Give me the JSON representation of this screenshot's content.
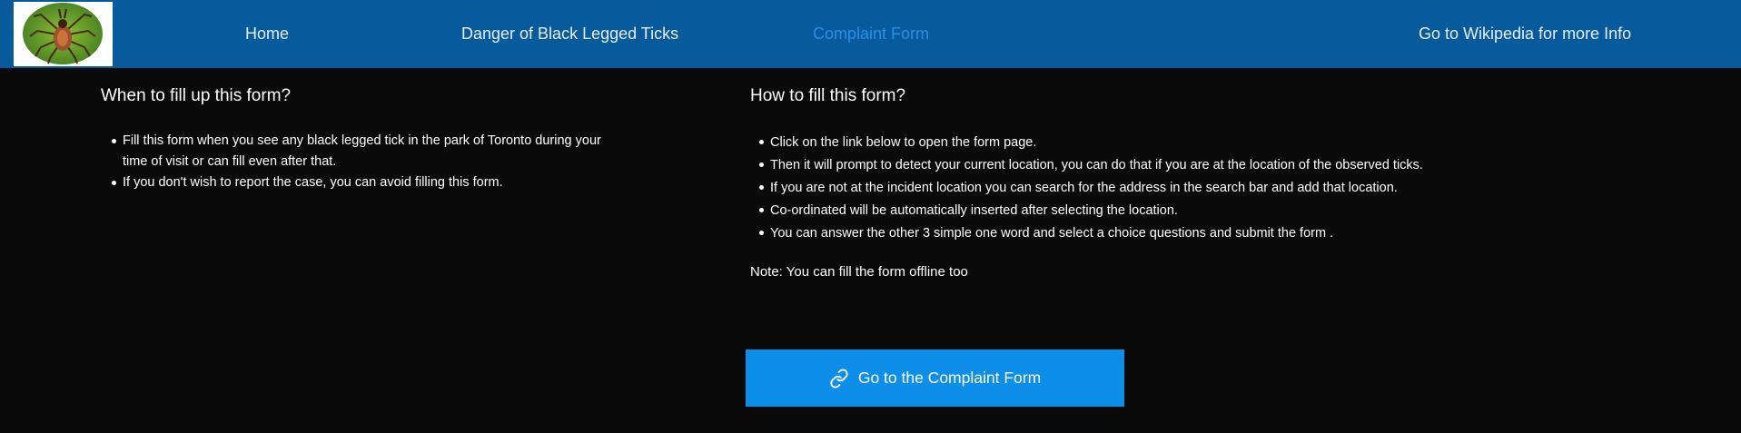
{
  "nav": {
    "logo_icon": "tick-logo-icon",
    "items": [
      {
        "label": "Home"
      },
      {
        "label": "Danger of Black Legged Ticks"
      },
      {
        "label": "Complaint Form"
      },
      {
        "label": "Go to Wikipedia for more Info"
      }
    ],
    "active_color": "#2a8ee6",
    "bar_color": "#075a9c"
  },
  "when": {
    "title": "When to fill up this form?",
    "items": [
      "Fill this form when you see any black legged tick in the park of Toronto during your time of visit or can fill even after that.",
      "If you don't wish to report the case, you can avoid filling this form."
    ]
  },
  "how": {
    "title": "How to fill this form?",
    "items": [
      "Click on the link below to open the form page.",
      "Then it will prompt to detect your current location, you can do that if you are at the location of the observed ticks.",
      "If you are not at the incident location you can search for the address in the search bar and add that location.",
      "Co-ordinated will be automatically inserted after selecting the location.",
      "You can answer the other 3 simple one word and select a choice questions and submit the form ."
    ],
    "note": "Note: You can fill the form offline too"
  },
  "cta": {
    "label": "Go to the Complaint Form",
    "icon": "link-icon",
    "color": "#0d8fe9"
  }
}
